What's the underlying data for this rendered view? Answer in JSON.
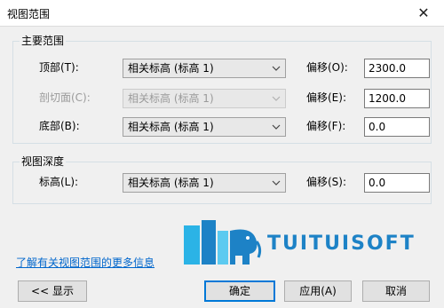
{
  "window": {
    "title": "视图范围",
    "close_glyph": "✕"
  },
  "primary": {
    "group_label": "主要范围",
    "rows": [
      {
        "label": "顶部(T):",
        "combo": "相关标高 (标高 1)",
        "offset_label": "偏移(O):",
        "offset": "2300.0",
        "disabled": false
      },
      {
        "label": "剖切面(C):",
        "combo": "相关标高 (标高 1)",
        "offset_label": "偏移(E):",
        "offset": "1200.0",
        "disabled": true
      },
      {
        "label": "底部(B):",
        "combo": "相关标高 (标高 1)",
        "offset_label": "偏移(F):",
        "offset": "0.0",
        "disabled": false
      }
    ]
  },
  "depth": {
    "group_label": "视图深度",
    "row": {
      "label": "标高(L):",
      "combo": "相关标高 (标高 1)",
      "offset_label": "偏移(S):",
      "offset": "0.0"
    }
  },
  "link_text": "了解有关视图范围的更多信息",
  "watermark": {
    "text": "TUITUISOFT",
    "icon": "elephant-logo-icon",
    "color": "#1d82c6"
  },
  "buttons": {
    "show": "<< 显示",
    "ok": "确定",
    "apply": "应用(A)",
    "cancel": "取消"
  },
  "colors": {
    "accent": "#0078d7",
    "link": "#0066cc"
  }
}
